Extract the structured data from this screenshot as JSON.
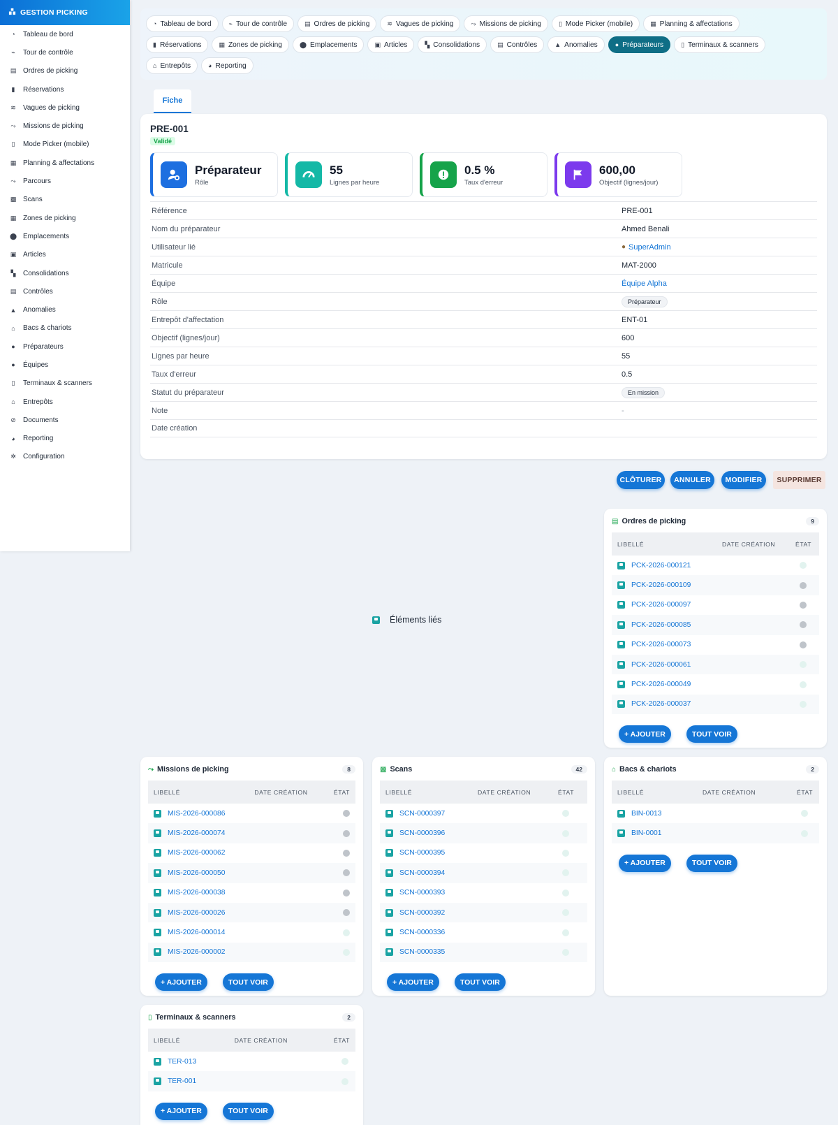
{
  "app": {
    "title": "GESTION PICKING"
  },
  "sidebar": {
    "items": [
      {
        "label": "Tableau de bord",
        "icon": "gauge-icon"
      },
      {
        "label": "Tour de contrôle",
        "icon": "satellite-icon"
      },
      {
        "label": "Ordres de picking",
        "icon": "clipboard-icon"
      },
      {
        "label": "Réservations",
        "icon": "bookmark-icon"
      },
      {
        "label": "Vagues de picking",
        "icon": "layers-icon"
      },
      {
        "label": "Missions de picking",
        "icon": "route-icon"
      },
      {
        "label": "Mode Picker (mobile)",
        "icon": "mobile-icon"
      },
      {
        "label": "Planning & affectations",
        "icon": "calendar-icon"
      },
      {
        "label": "Parcours",
        "icon": "route-icon"
      },
      {
        "label": "Scans",
        "icon": "qrcode-icon"
      },
      {
        "label": "Zones de picking",
        "icon": "grid-icon"
      },
      {
        "label": "Emplacements",
        "icon": "location-pin-icon"
      },
      {
        "label": "Articles",
        "icon": "box-icon"
      },
      {
        "label": "Consolidations",
        "icon": "boxes-icon"
      },
      {
        "label": "Contrôles",
        "icon": "clipboard-check-icon"
      },
      {
        "label": "Anomalies",
        "icon": "warning-icon"
      },
      {
        "label": "Bacs & chariots",
        "icon": "basket-icon"
      },
      {
        "label": "Préparateurs",
        "icon": "user-gear-icon"
      },
      {
        "label": "Équipes",
        "icon": "users-icon"
      },
      {
        "label": "Terminaux & scanners",
        "icon": "mobile-icon"
      },
      {
        "label": "Entrepôts",
        "icon": "warehouse-icon"
      },
      {
        "label": "Documents",
        "icon": "paperclip-icon"
      },
      {
        "label": "Reporting",
        "icon": "pie-chart-icon"
      },
      {
        "label": "Configuration",
        "icon": "gear-icon"
      }
    ]
  },
  "topnav": {
    "row1": [
      "Tableau de bord",
      "Tour de contrôle",
      "Ordres de picking",
      "Vagues de picking",
      "Missions de picking",
      "Mode Picker (mobile)",
      "Planning & affectations"
    ],
    "row2": [
      "Réservations",
      "Zones de picking",
      "Emplacements",
      "Articles",
      "Consolidations",
      "Contrôles",
      "Anomalies",
      "Préparateurs",
      "Terminaux & scanners"
    ],
    "row3": [
      "Entrepôts",
      "Reporting"
    ],
    "active": "Préparateurs"
  },
  "tab": {
    "label": "Fiche"
  },
  "fiche": {
    "title": "PRE-001",
    "status": "Validé",
    "kpis": [
      {
        "value": "Préparateur",
        "label": "Rôle",
        "color": "#1d6fe0"
      },
      {
        "value": "55",
        "label": "Lignes par heure",
        "color": "#14b8a6"
      },
      {
        "value": "0.5 %",
        "label": "Taux d'erreur",
        "color": "#16a34a"
      },
      {
        "value": "600,00",
        "label": "Objectif (lignes/jour)",
        "color": "#7c3aed"
      }
    ],
    "fields": [
      {
        "label": "Référence",
        "value": "PRE-001"
      },
      {
        "label": "Nom du préparateur",
        "value": "Ahmed Benali"
      },
      {
        "label": "Utilisateur lié",
        "value": "SuperAdmin"
      },
      {
        "label": "Matricule",
        "value": "MAT-2000"
      },
      {
        "label": "Équipe",
        "value": "Équipe Alpha"
      },
      {
        "label": "Rôle",
        "value": "Préparateur"
      },
      {
        "label": "Entrepôt d'affectation",
        "value": "ENT-01"
      },
      {
        "label": "Objectif (lignes/jour)",
        "value": "600"
      },
      {
        "label": "Lignes par heure",
        "value": "55"
      },
      {
        "label": "Taux d'erreur",
        "value": "0.5"
      },
      {
        "label": "Statut du préparateur",
        "value": "En mission"
      },
      {
        "label": "Note",
        "value": "-"
      },
      {
        "label": "Date création",
        "value": ""
      }
    ]
  },
  "actions": {
    "close": "CLÔTURER",
    "cancel": "ANNULER",
    "edit": "MODIFIER",
    "delete": "SUPPRIMER"
  },
  "related": {
    "label": "Éléments liés"
  },
  "table_headers": {
    "lib": "LIBELLÉ",
    "date": "DATE CRÉATION",
    "state": "ÉTAT"
  },
  "buttons": {
    "add": "+ AJOUTER",
    "all": "TOUT VOIR"
  },
  "panels": {
    "ordres": {
      "title": "Ordres de picking",
      "count": "9",
      "rows": [
        {
          "lib": "PCK-2026-000121",
          "state": "light"
        },
        {
          "lib": "PCK-2026-000109",
          "state": "grey"
        },
        {
          "lib": "PCK-2026-000097",
          "state": "grey"
        },
        {
          "lib": "PCK-2026-000085",
          "state": "grey"
        },
        {
          "lib": "PCK-2026-000073",
          "state": "grey"
        },
        {
          "lib": "PCK-2026-000061",
          "state": "light"
        },
        {
          "lib": "PCK-2026-000049",
          "state": "light"
        },
        {
          "lib": "PCK-2026-000037",
          "state": "light"
        }
      ]
    },
    "missions": {
      "title": "Missions de picking",
      "count": "8",
      "rows": [
        {
          "lib": "MIS-2026-000086",
          "state": "grey"
        },
        {
          "lib": "MIS-2026-000074",
          "state": "grey"
        },
        {
          "lib": "MIS-2026-000062",
          "state": "grey"
        },
        {
          "lib": "MIS-2026-000050",
          "state": "grey"
        },
        {
          "lib": "MIS-2026-000038",
          "state": "grey"
        },
        {
          "lib": "MIS-2026-000026",
          "state": "grey"
        },
        {
          "lib": "MIS-2026-000014",
          "state": "light"
        },
        {
          "lib": "MIS-2026-000002",
          "state": "light"
        }
      ]
    },
    "scans": {
      "title": "Scans",
      "count": "42",
      "rows": [
        {
          "lib": "SCN-0000397",
          "state": "light"
        },
        {
          "lib": "SCN-0000396",
          "state": "light"
        },
        {
          "lib": "SCN-0000395",
          "state": "light"
        },
        {
          "lib": "SCN-0000394",
          "state": "light"
        },
        {
          "lib": "SCN-0000393",
          "state": "light"
        },
        {
          "lib": "SCN-0000392",
          "state": "light"
        },
        {
          "lib": "SCN-0000336",
          "state": "light"
        },
        {
          "lib": "SCN-0000335",
          "state": "light"
        }
      ]
    },
    "bacs": {
      "title": "Bacs & chariots",
      "count": "2",
      "rows": [
        {
          "lib": "BIN-0013",
          "state": "light"
        },
        {
          "lib": "BIN-0001",
          "state": "light"
        }
      ]
    },
    "terminaux": {
      "title": "Terminaux & scanners",
      "count": "2",
      "rows": [
        {
          "lib": "TER-013",
          "state": "light"
        },
        {
          "lib": "TER-001",
          "state": "light"
        }
      ]
    }
  }
}
